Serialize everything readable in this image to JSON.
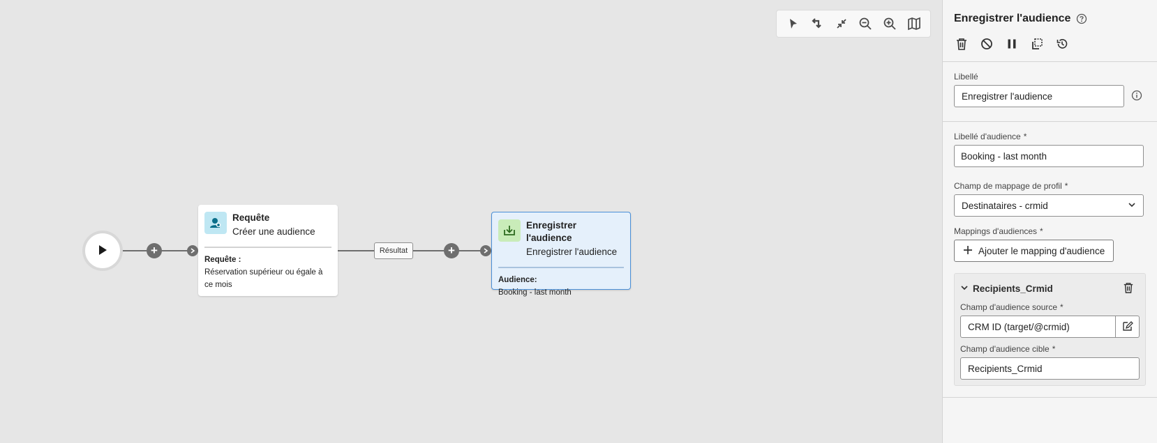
{
  "canvas": {
    "toolbar": [
      {
        "name": "select-icon",
        "label": "select"
      },
      {
        "name": "auto-layout-icon",
        "label": "layout"
      },
      {
        "name": "collapse-icon",
        "label": "collapse"
      },
      {
        "name": "zoom-out-icon",
        "label": "zoom out"
      },
      {
        "name": "zoom-in-icon",
        "label": "zoom in"
      },
      {
        "name": "map-icon",
        "label": "map"
      }
    ],
    "query_node": {
      "title": "Requête",
      "subtitle": "Créer une audience",
      "detail_label": "Requête :",
      "detail_value": "Réservation supérieur ou égale à ce mois",
      "icon": "user-search-icon",
      "icon_color": "#bfe7f3"
    },
    "result_label": "Résultat",
    "save_node": {
      "title": "Enregistrer l'audience",
      "subtitle": "Enregistrer l'audience",
      "detail_label": "Audience:",
      "detail_value": "Booking - last month",
      "icon": "download-icon",
      "icon_color": "#c9ecb9"
    }
  },
  "panel": {
    "title": "Enregistrer l'audience",
    "actions": [
      "delete-icon",
      "disable-icon",
      "pause-icon",
      "copy-icon",
      "history-icon"
    ],
    "libelle": {
      "label": "Libellé",
      "value": "Enregistrer l'audience"
    },
    "audience_label": {
      "label": "Libellé d'audience",
      "value": "Booking - last month"
    },
    "profile_mapping": {
      "label": "Champ de mappage de profil",
      "value": "Destinataires - crmid"
    },
    "audience_mappings": {
      "label": "Mappings d'audiences",
      "add_button": "Ajouter le mapping d'audience"
    },
    "mapping_card": {
      "title": "Recipients_Crmid",
      "source_label": "Champ d'audience source",
      "source_value": "CRM ID (target/@crmid)",
      "target_label": "Champ d'audience cible",
      "target_value": "Recipients_Crmid"
    },
    "required_marker": "*"
  },
  "colors": {
    "canvas_bg": "#e6e6e6",
    "selected_border": "#4a8fd8",
    "selected_bg": "#e5f0fb",
    "edge": "#6e6e6e"
  }
}
